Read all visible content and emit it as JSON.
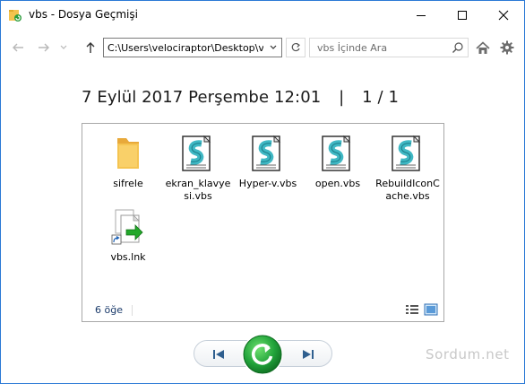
{
  "window": {
    "title": "vbs - Dosya Geçmişi",
    "minimize_icon": "minimize-icon",
    "maximize_icon": "maximize-icon",
    "close_icon": "close-icon"
  },
  "nav": {
    "back_icon": "back-arrow-icon",
    "forward_icon": "forward-arrow-icon",
    "recent_icon": "chevron-down-icon",
    "up_icon": "up-arrow-icon",
    "address": "C:\\Users\\velociraptor\\Desktop\\vbs",
    "refresh_icon": "refresh-icon",
    "search_placeholder": "vbs İçinde Ara",
    "home_icon": "home-icon",
    "settings_icon": "gear-icon"
  },
  "header": {
    "date": "7 Eylül 2017 Perşembe 12:01",
    "separator": "|",
    "page": "1 / 1"
  },
  "files": [
    {
      "name": "sifrele",
      "type": "folder"
    },
    {
      "name": "ekran_klavyesi.vbs",
      "type": "vbs"
    },
    {
      "name": "Hyper-v.vbs",
      "type": "vbs"
    },
    {
      "name": "open.vbs",
      "type": "vbs"
    },
    {
      "name": "RebuildIconCache.vbs",
      "type": "vbs"
    },
    {
      "name": "vbs.lnk",
      "type": "lnk"
    }
  ],
  "status": {
    "count": "6 öğe",
    "details_view_icon": "details-view-icon",
    "large_icons_view_icon": "large-icons-view-icon"
  },
  "controls": {
    "previous_icon": "skip-previous-icon",
    "restore_icon": "restore-icon",
    "next_icon": "skip-next-icon"
  },
  "watermark": "Sordum.net",
  "colors": {
    "border": "#2b79d6",
    "restore_green": "#21a33a",
    "folder_yellow": "#f5c451",
    "vbs_teal": "#3fb8c4"
  }
}
